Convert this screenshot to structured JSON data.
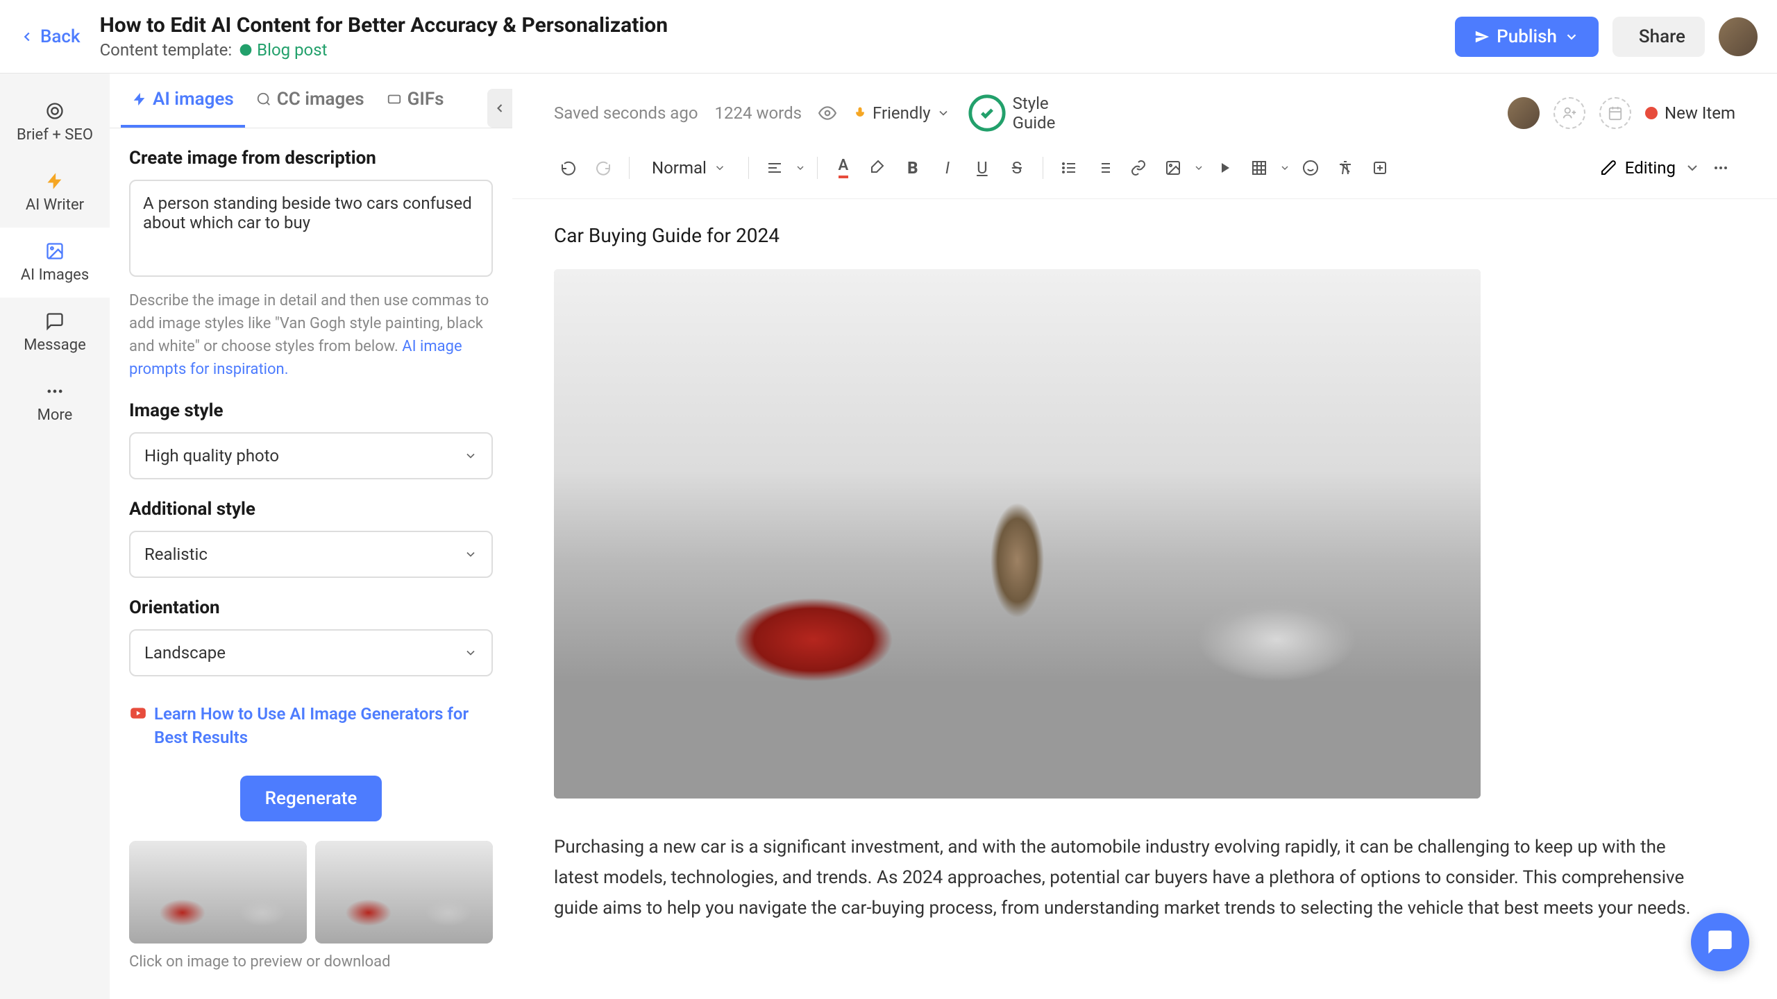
{
  "header": {
    "back": "Back",
    "title": "How to Edit AI Content for Better Accuracy & Personalization",
    "subtitle_label": "Content template:",
    "template_name": "Blog post",
    "publish": "Publish",
    "share": "Share"
  },
  "leftbar": {
    "items": [
      {
        "label": "Brief + SEO"
      },
      {
        "label": "AI Writer"
      },
      {
        "label": "AI Images"
      },
      {
        "label": "Message"
      },
      {
        "label": "More"
      }
    ]
  },
  "sidebar": {
    "tabs": [
      {
        "label": "AI images"
      },
      {
        "label": "CC images"
      },
      {
        "label": "GIFs"
      }
    ],
    "create_label": "Create image from description",
    "description_value": "A person standing beside two cars confused about which car to buy",
    "help_text": "Describe the image in detail and then use commas to add image styles like \"Van Gogh style painting, black and white\" or choose styles from below. ",
    "help_link": "AI image prompts for inspiration.",
    "image_style_label": "Image style",
    "image_style_value": "High quality photo",
    "additional_style_label": "Additional style",
    "additional_style_value": "Realistic",
    "orientation_label": "Orientation",
    "orientation_value": "Landscape",
    "learn_link": "Learn How to Use AI Image Generators for Best Results",
    "regenerate": "Regenerate",
    "thumb_hint": "Click on image to preview or download"
  },
  "editor": {
    "saved": "Saved seconds ago",
    "word_count": "1224 words",
    "tone": "Friendly",
    "style_guide": "Style Guide",
    "new_item": "New Item",
    "format_select": "Normal",
    "editing_mode": "Editing",
    "doc_title": "Car Buying Guide for 2024",
    "doc_body": "Purchasing a new car is a significant investment, and with the automobile industry evolving rapidly, it can be challenging to keep up with the latest models, technologies, and trends. As 2024 approaches, potential car buyers have a plethora of options to consider. This comprehensive guide aims to help you navigate the car-buying process, from understanding market trends to selecting the vehicle that best meets your needs."
  }
}
